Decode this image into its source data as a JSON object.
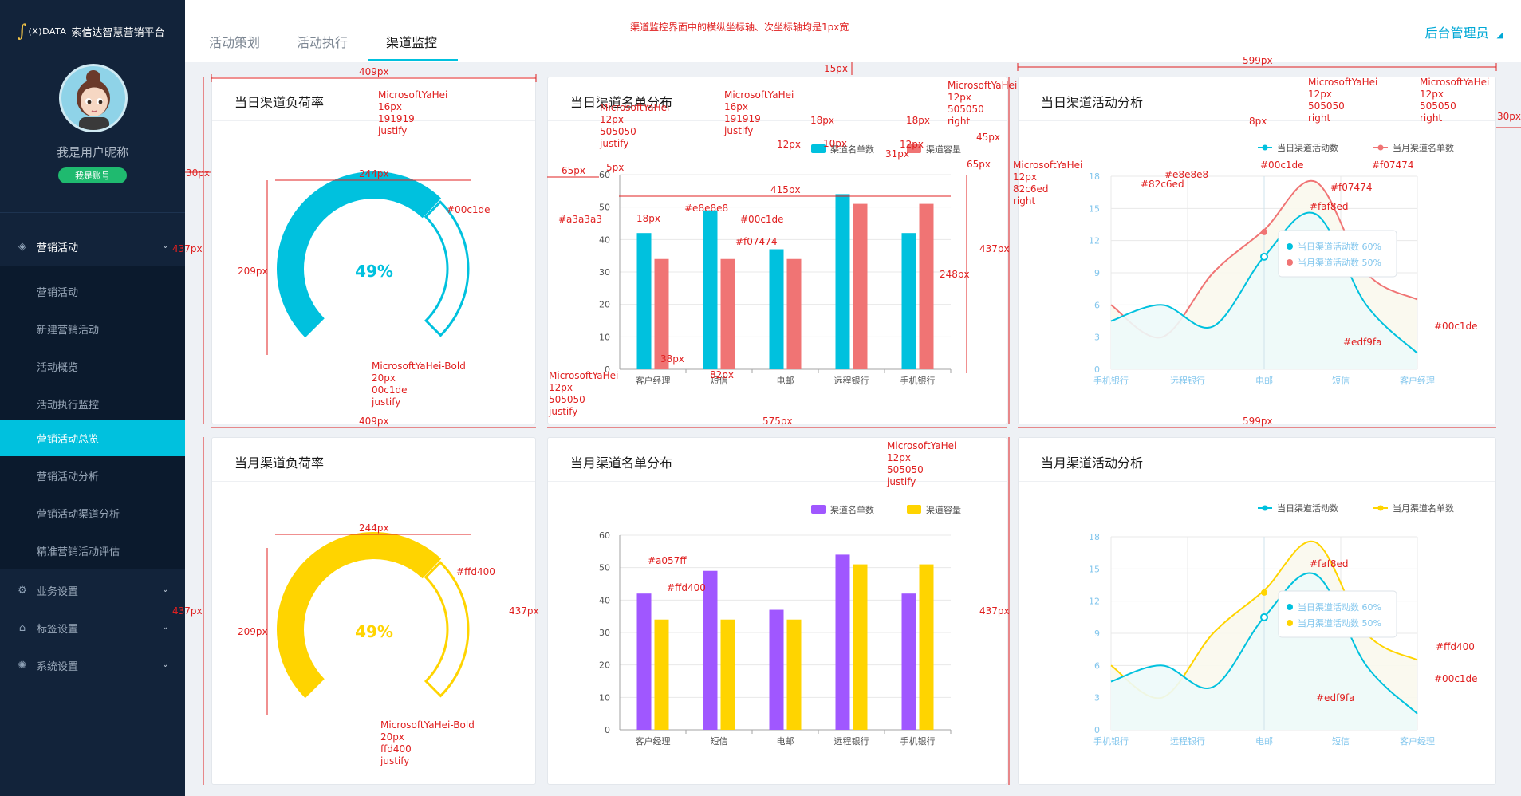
{
  "sidebar": {
    "logo_mark": "∫",
    "logo_brand": "(X)DATA",
    "logo_platform": "索信达智慧营销平台",
    "nickname": "我是用户昵称",
    "account_badge": "我是账号",
    "groups": [
      {
        "label": "营销活动",
        "icon": "layers-icon"
      },
      {
        "label": "业务设置",
        "icon": "gear-icon"
      },
      {
        "label": "标签设置",
        "icon": "tag-icon"
      },
      {
        "label": "系统设置",
        "icon": "settings-icon"
      }
    ],
    "sub_items": [
      "营销活动",
      "新建营销活动",
      "活动概览",
      "活动执行监控",
      "营销活动总览",
      "营销活动分析",
      "营销活动渠道分析",
      "精准营销活动评估"
    ],
    "active_sub_item": "营销活动总览"
  },
  "topbar": {
    "tabs": [
      "活动策划",
      "活动执行",
      "渠道监控"
    ],
    "active_tab": "渠道监控",
    "admin": "后台管理员"
  },
  "colors": {
    "cyan": "#00c1de",
    "salmon": "#f07474",
    "purple": "#a057ff",
    "yellow": "#ffd400",
    "grid": "#e8e8e8",
    "axis": "#a3a3a3",
    "text": "#505050",
    "title": "#191919",
    "area": "#edf9fa",
    "area2": "#faf8ed"
  },
  "cards": {
    "daily_load": {
      "title": "当日渠道负荷率"
    },
    "daily_list": {
      "title": "当日渠道名单分布"
    },
    "daily_activity": {
      "title": "当日渠道活动分析"
    },
    "monthly_load": {
      "title": "当月渠道负荷率"
    },
    "monthly_list": {
      "title": "当月渠道名单分布"
    },
    "monthly_activity": {
      "title": "当月渠道活动分析"
    }
  },
  "chart_data": [
    {
      "id": "daily_load",
      "type": "gauge",
      "title": "当日渠道负荷率",
      "value": 49,
      "label": "49%",
      "color": "#00c1de"
    },
    {
      "id": "daily_list",
      "type": "bar",
      "title": "当日渠道名单分布",
      "categories": [
        "客户经理",
        "短信",
        "电邮",
        "远程银行",
        "手机银行"
      ],
      "ylim": [
        0,
        60
      ],
      "yticks": [
        0,
        10,
        20,
        30,
        40,
        50,
        60
      ],
      "series": [
        {
          "name": "渠道名单数",
          "color": "#00c1de",
          "values": [
            42,
            49,
            37,
            54,
            42
          ]
        },
        {
          "name": "渠道容量",
          "color": "#f07474",
          "values": [
            34,
            34,
            34,
            51,
            51
          ]
        }
      ],
      "legend": "top-right"
    },
    {
      "id": "daily_activity",
      "type": "area",
      "title": "当日渠道活动分析",
      "categories": [
        "手机银行",
        "远程银行",
        "电邮",
        "短信",
        "客户经理"
      ],
      "ylim": [
        0,
        18
      ],
      "yticks": [
        0,
        3,
        6,
        9,
        12,
        15,
        18
      ],
      "series": [
        {
          "name": "当日渠道活动数",
          "color": "#00c1de",
          "values": [
            4.5,
            6,
            4,
            10.5,
            14.5,
            6,
            1.5
          ]
        },
        {
          "name": "当月渠道名单数",
          "color": "#f07474",
          "values": [
            6,
            3,
            9,
            13,
            17.5,
            9,
            6.5
          ]
        }
      ],
      "tooltip": [
        {
          "label": "当日渠道活动数",
          "value": "60%"
        },
        {
          "label": "当月渠道活动数",
          "value": "50%"
        }
      ],
      "legend": "top-right"
    },
    {
      "id": "monthly_load",
      "type": "gauge",
      "title": "当月渠道负荷率",
      "value": 49,
      "label": "49%",
      "color": "#ffd400"
    },
    {
      "id": "monthly_list",
      "type": "bar",
      "title": "当月渠道名单分布",
      "categories": [
        "客户经理",
        "短信",
        "电邮",
        "远程银行",
        "手机银行"
      ],
      "ylim": [
        0,
        60
      ],
      "yticks": [
        0,
        10,
        20,
        30,
        40,
        50,
        60
      ],
      "series": [
        {
          "name": "渠道名单数",
          "color": "#a057ff",
          "values": [
            42,
            49,
            37,
            54,
            42
          ]
        },
        {
          "name": "渠道容量",
          "color": "#ffd400",
          "values": [
            34,
            34,
            34,
            51,
            51
          ]
        }
      ],
      "legend": "top-right"
    },
    {
      "id": "monthly_activity",
      "type": "area",
      "title": "当月渠道活动分析",
      "categories": [
        "手机银行",
        "远程银行",
        "电邮",
        "短信",
        "客户经理"
      ],
      "ylim": [
        0,
        18
      ],
      "yticks": [
        0,
        3,
        6,
        9,
        12,
        15,
        18
      ],
      "series": [
        {
          "name": "当日渠道活动数",
          "color": "#00c1de",
          "values": [
            4.5,
            6,
            4,
            10.5,
            14.5,
            6,
            1.5
          ]
        },
        {
          "name": "当月渠道名单数",
          "color": "#ffd400",
          "values": [
            6,
            3,
            9,
            13,
            17.5,
            9,
            6.5
          ]
        }
      ],
      "tooltip": [
        {
          "label": "当日渠道活动数",
          "value": "60%"
        },
        {
          "label": "当月渠道活动数",
          "value": "50%"
        }
      ],
      "legend": "top-right"
    }
  ],
  "annotations": {
    "top_note": "渠道监控界面中的横纵坐标轴、次坐标轴均是1px宽",
    "w409": "409px",
    "w575": "575px",
    "w599": "599px",
    "h437": "437px",
    "h15": "15px",
    "h30": "30px",
    "w244": "244px",
    "h209": "209px",
    "w415": "415px",
    "h248": "248px",
    "w65": "65px",
    "w18": "18px",
    "w12": "12px",
    "w10": "10px",
    "w31": "31px",
    "w45": "45px",
    "h38": "38px",
    "w82": "82px",
    "w5": "5px",
    "w8": "8px",
    "font_title": "MicrosoftYaHei\n16px\n191919\njustify",
    "font_small_right": "MicrosoftYaHei\n12px\n505050\nright",
    "font_small_justify": "MicrosoftYaHei\n12px\n505050\njustify",
    "font_axis": "MicrosoftYaHei\n12px\n82c6ed\nright",
    "font_gauge_cyan": "MicrosoftYaHei-Bold\n20px\n00c1de\njustify",
    "font_gauge_yellow": "MicrosoftYaHei-Bold\n20px\nffd400\njustify",
    "c_00c1de": "#00c1de",
    "c_e8e8e8": "#e8e8e8",
    "c_a3a3a3": "#a3a3a3",
    "c_f07474": "#f07474",
    "c_82c6ed": "#82c6ed",
    "c_faf8ed": "#faf8ed",
    "c_edf9fa": "#edf9fa",
    "c_a057ff": "#a057ff",
    "c_ffd400": "#ffd400",
    "c_ffd400_2": "ffd400",
    "c_00c1de_2": "00c1de"
  }
}
